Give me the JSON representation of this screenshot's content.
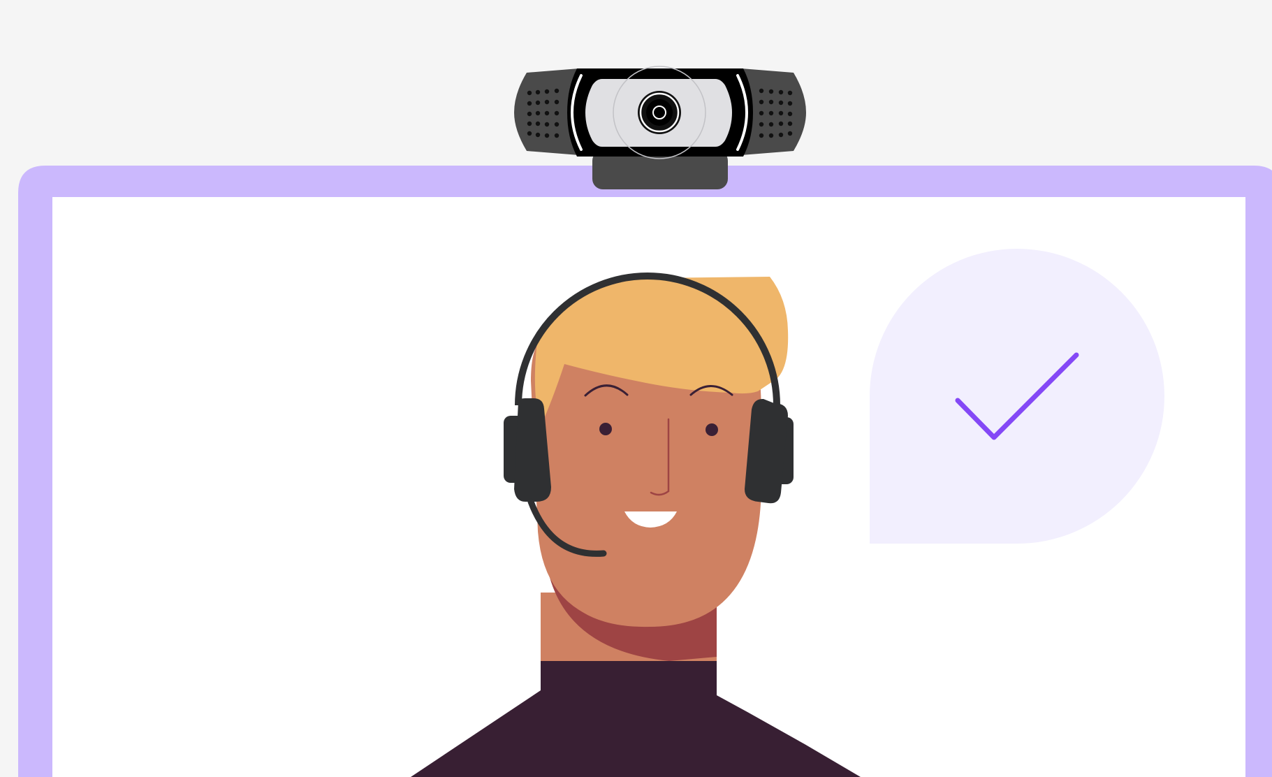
{
  "illustration": {
    "colors": {
      "background": "#f5f5f5",
      "monitor_frame": "#cbb8fd",
      "screen": "#ffffff",
      "webcam_body": "#4a4a4a",
      "webcam_face": "#000000",
      "webcam_lens_panel": "#e0e0e3",
      "hair": "#efb66a",
      "skin": "#cf8162",
      "skin_shadow": "#9e4444",
      "shirt": "#381f33",
      "headset": "#2f3032",
      "facial_features": "#3a2035",
      "speech_bubble": "#f2effe",
      "checkmark": "#8448f6"
    },
    "icons": {
      "webcam": "webcam-icon",
      "headset": "headset-icon",
      "speech_bubble": "speech-bubble-icon",
      "checkmark": "checkmark-icon"
    }
  }
}
